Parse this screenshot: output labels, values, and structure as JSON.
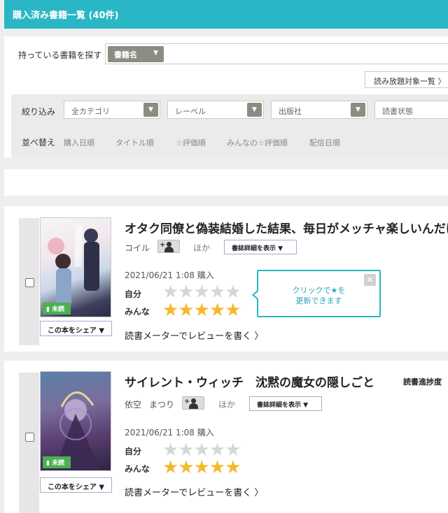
{
  "header": {
    "title": "購入済み書籍一覧 (40件)"
  },
  "search": {
    "label": "持っている書籍を探す",
    "selected": "書籍名",
    "arrow": "▼"
  },
  "unlimited_button": "読み放題対象一覧 〉",
  "filter": {
    "label": "絞り込み",
    "dropdowns": [
      "全カテゴリ",
      "レーベル",
      "出版社",
      "読書状態"
    ]
  },
  "sort": {
    "label": "並べ替え",
    "options": [
      "購入日順",
      "タイトル順",
      "☆評価順",
      "みんなの☆評価順",
      "配信日順"
    ]
  },
  "tooltip": {
    "line1": "クリックで★を",
    "line2": "更新できます",
    "close": "×"
  },
  "books": [
    {
      "title": "オタク同僚と偽装結婚した結果、毎日がメッチャ楽しいんだけど！",
      "authors": [
        "コイル"
      ],
      "others": "ほか",
      "detail_button": "書誌詳細を表示 ▼",
      "purchase_date": "2021/06/21 1:08 購入",
      "my_rating_label": "自分",
      "all_rating_label": "みんな",
      "my_rating": 0,
      "all_rating": 5,
      "unread": "未読",
      "share": "この本をシェア ▼",
      "review": "読書メーターでレビューを書く 〉"
    },
    {
      "title": "サイレント・ウィッチ　沈黙の魔女の隠しごと",
      "progress": "読書進捗度",
      "authors": [
        "依空",
        "まつり"
      ],
      "others": "ほか",
      "detail_button": "書誌詳細を表示 ▼",
      "purchase_date": "2021/06/21 1:08 購入",
      "my_rating_label": "自分",
      "all_rating_label": "みんな",
      "my_rating": 0,
      "all_rating": 5,
      "unread": "未読",
      "share": "この本をシェア ▼",
      "review": "読書メーターでレビューを書く 〉"
    }
  ],
  "colors": {
    "accent": "#29b6c5",
    "star": "#f4b92c",
    "unread": "#4caf50"
  }
}
